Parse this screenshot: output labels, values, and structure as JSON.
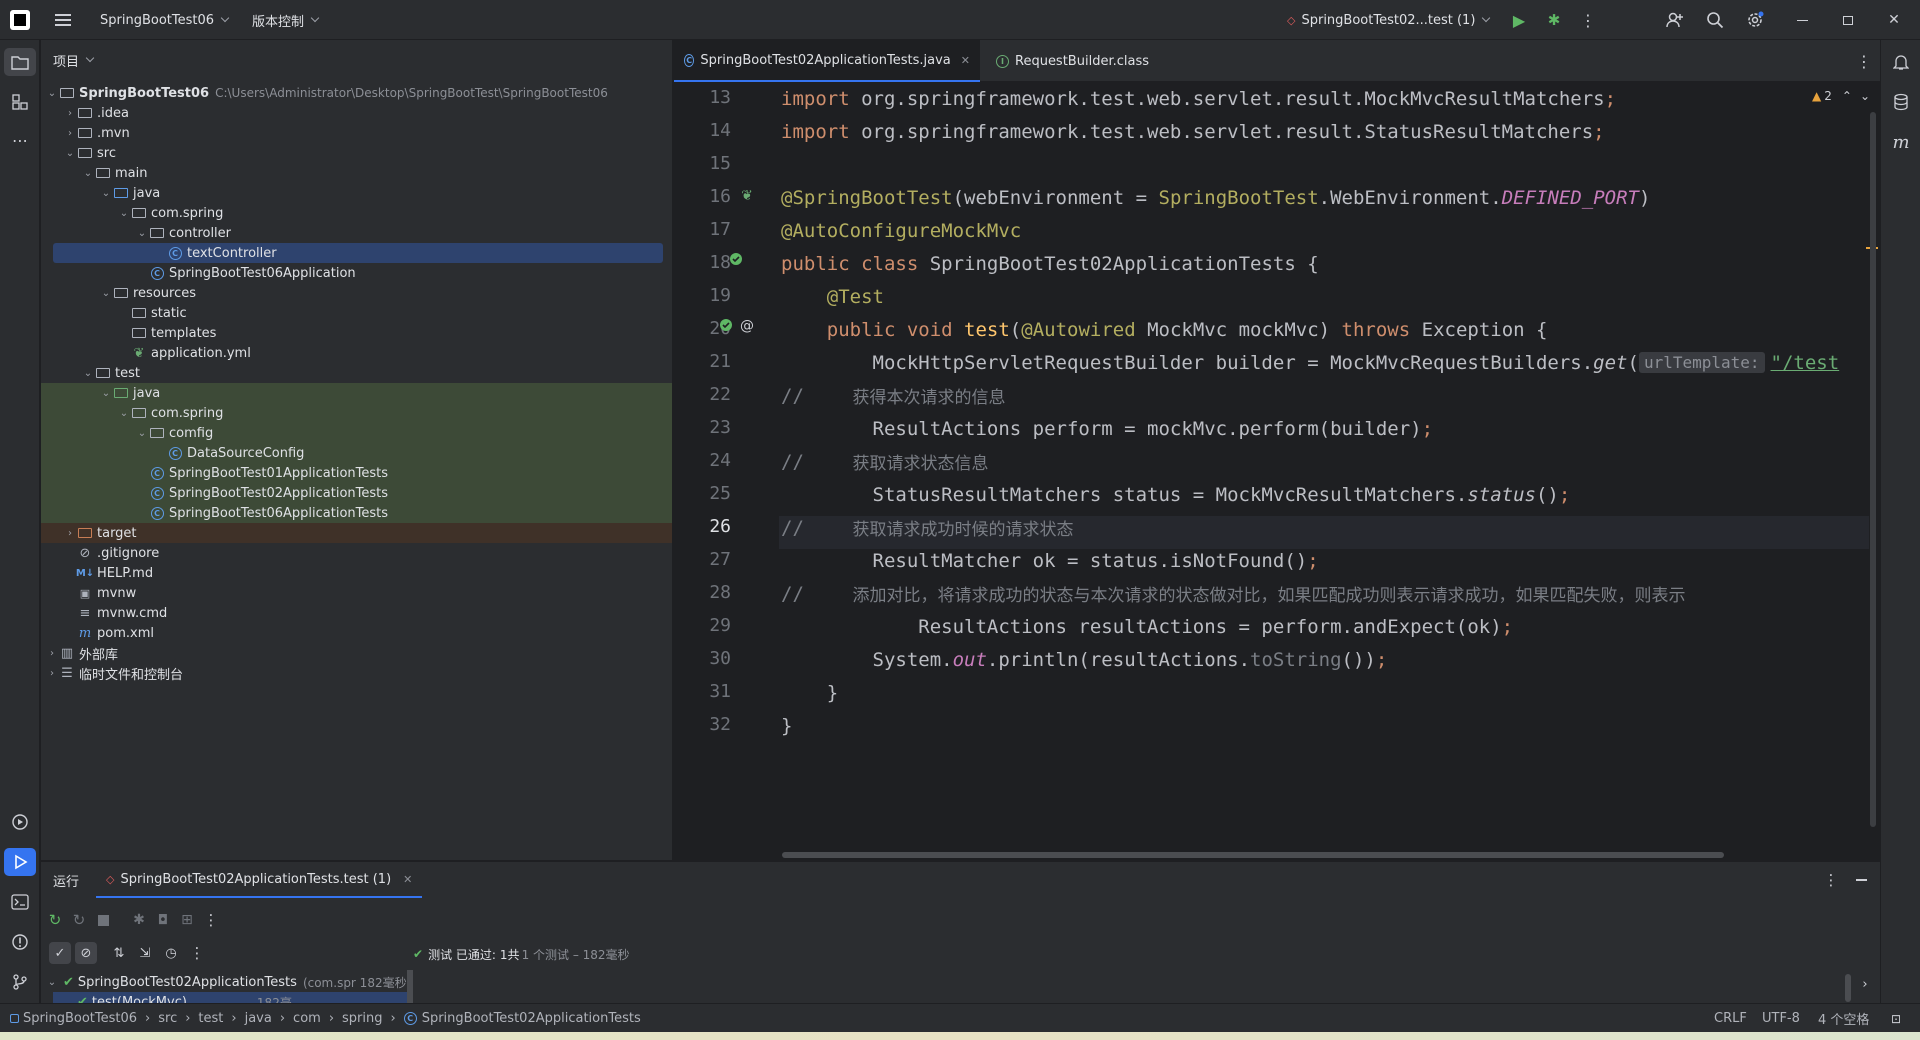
{
  "titlebar": {
    "project_name": "SpringBootTest06",
    "vcs_label": "版本控制",
    "run_config": "SpringBootTest02...test (1)"
  },
  "project_panel": {
    "header": "项目",
    "rows": [
      {
        "label": "SpringBootTest06",
        "path": "C:\\Users\\Administrator\\Desktop\\SpringBootTest\\SpringBootTest06"
      },
      {
        "label": ".idea"
      },
      {
        "label": ".mvn"
      },
      {
        "label": "src"
      },
      {
        "label": "main"
      },
      {
        "label": "java"
      },
      {
        "label": "com.spring"
      },
      {
        "label": "controller"
      },
      {
        "label": "textController"
      },
      {
        "label": "SpringBootTest06Application"
      },
      {
        "label": "resources"
      },
      {
        "label": "static"
      },
      {
        "label": "templates"
      },
      {
        "label": "application.yml"
      },
      {
        "label": "test"
      },
      {
        "label": "java"
      },
      {
        "label": "com.spring"
      },
      {
        "label": "comfig"
      },
      {
        "label": "DataSourceConfig"
      },
      {
        "label": "SpringBootTest01ApplicationTests"
      },
      {
        "label": "SpringBootTest02ApplicationTests"
      },
      {
        "label": "SpringBootTest06ApplicationTests"
      },
      {
        "label": "target"
      },
      {
        "label": ".gitignore"
      },
      {
        "label": "HELP.md"
      },
      {
        "label": "mvnw"
      },
      {
        "label": "mvnw.cmd"
      },
      {
        "label": "pom.xml"
      },
      {
        "label": "外部库"
      },
      {
        "label": "临时文件和控制台"
      }
    ]
  },
  "editor": {
    "tabs": [
      {
        "label": "SpringBootTest02ApplicationTests.java"
      },
      {
        "label": "RequestBuilder.class"
      }
    ],
    "warning_count": "2",
    "line_numbers": [
      "13",
      "14",
      "15",
      "16",
      "17",
      "18",
      "19",
      "20",
      "21",
      "22",
      "23",
      "24",
      "25",
      "26",
      "27",
      "28",
      "29",
      "30",
      "31",
      "32"
    ],
    "code": {
      "l13a": "import ",
      "l13b": "org.springframework.test.web.servlet.result.MockMvcResultMatchers",
      "l13c": ";",
      "l14a": "import ",
      "l14b": "org.springframework.test.web.servlet.result.StatusResultMatchers",
      "l14c": ";",
      "l16a": "@SpringBootTest",
      "l16b": "(webEnvironment = ",
      "l16c": "SpringBootTest",
      "l16d": ".WebEnvironment.",
      "l16e": "DEFINED_PORT",
      "l16f": ")",
      "l17a": "@AutoConfigureMockMvc",
      "l18a": "public class ",
      "l18b": "SpringBootTest02ApplicationTests {",
      "l19a": "    @Test",
      "l20a": "    public void ",
      "l20b": "test",
      "l20c": "(",
      "l20d": "@Autowired",
      "l20e": " MockMvc mockMvc) ",
      "l20f": "throws",
      "l20g": " Exception {",
      "l21a": "        MockHttpServletRequestBuilder builder = MockMvcRequestBuilders.",
      "l21b": "get",
      "l21c": "(",
      "l21hint": "urlTemplate:",
      "l21d": "\"/test",
      "l22a": "//",
      "l22b": "         获得本次请求的信息",
      "l23a": "        ResultActions perform = mockMvc.perform(builder)",
      "l23b": ";",
      "l24a": "//",
      "l24b": "         获取请求状态信息",
      "l25a": "        StatusResultMatchers status = MockMvcResultMatchers.",
      "l25b": "status",
      "l25c": "()",
      "l25d": ";",
      "l26a": "//",
      "l26b": "         获取请求成功时候的请求状态",
      "l27a": "        ResultMatcher ok = status.isNotFound()",
      "l27b": ";",
      "l28a": "//",
      "l28b": "         添加对比，将请求成功的状态与本次请求的状态做对比，如果匹配成功则表示请求成功，如果匹配失败，则表示",
      "l29a": "            ResultActions resultActions = perform.andExpect(ok)",
      "l29b": ";",
      "l30a": "        System.",
      "l30b": "out",
      "l30c": ".println(resultActions.",
      "l30d": "toString",
      "l30e": "())",
      "l30f": ";",
      "l31a": "    }",
      "l32a": "}"
    }
  },
  "run_panel": {
    "tab_run": "运行",
    "tab_test": "SpringBootTest02ApplicationTests.test (1)",
    "result_prefix": "测试 已通过:",
    "result_count": "1共",
    "result_detail": "1 个测试 – 182毫秒",
    "tree_root": "SpringBootTest02ApplicationTests",
    "tree_root_meta": "(com.spr 182毫秒",
    "tree_child": "test(MockMvc)",
    "tree_child_meta": "182毫"
  },
  "statusbar": {
    "breadcrumbs": [
      "SpringBootTest06",
      "src",
      "test",
      "java",
      "com",
      "spring",
      "SpringBootTest02ApplicationTests"
    ],
    "line_ending": "CRLF",
    "encoding": "UTF-8",
    "indent": "4 个空格"
  },
  "colors": {
    "accent": "#3574f0",
    "selection": "#2e436e",
    "test_bg": "#3d4a37"
  }
}
